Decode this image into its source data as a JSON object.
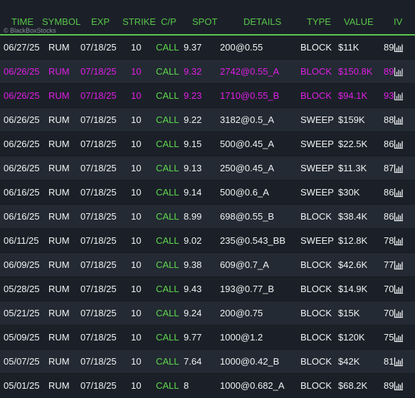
{
  "header": {
    "columns": [
      "TIME",
      "SYMBOL",
      "EXP",
      "STRIKE",
      "C/P",
      "SPOT",
      "DETAILS",
      "TYPE",
      "VALUE",
      "IV"
    ],
    "watermark": "© BlackBoxStocks"
  },
  "icons": {
    "iv_chart": "bar-chart-icon"
  },
  "colors": {
    "header_text": "#58c64a",
    "call_text": "#5fd84d",
    "highlight_text": "#e11ee6",
    "row_text": "#f1f3f5"
  },
  "rows": [
    {
      "time": "06/27/25",
      "symbol": "RUM",
      "exp": "07/18/25",
      "strike": "10",
      "cp": "CALL",
      "spot": "9.37",
      "details": "200@0.55",
      "type": "BLOCK",
      "value": "$11K",
      "iv": "89",
      "highlight": false
    },
    {
      "time": "06/26/25",
      "symbol": "RUM",
      "exp": "07/18/25",
      "strike": "10",
      "cp": "CALL",
      "spot": "9.32",
      "details": "2742@0.55_A",
      "type": "BLOCK",
      "value": "$150.8K",
      "iv": "89",
      "highlight": true
    },
    {
      "time": "06/26/25",
      "symbol": "RUM",
      "exp": "07/18/25",
      "strike": "10",
      "cp": "CALL",
      "spot": "9.23",
      "details": "1710@0.55_B",
      "type": "BLOCK",
      "value": "$94.1K",
      "iv": "93",
      "highlight": true
    },
    {
      "time": "06/26/25",
      "symbol": "RUM",
      "exp": "07/18/25",
      "strike": "10",
      "cp": "CALL",
      "spot": "9.22",
      "details": "3182@0.5_A",
      "type": "SWEEP",
      "value": "$159K",
      "iv": "88",
      "highlight": false
    },
    {
      "time": "06/26/25",
      "symbol": "RUM",
      "exp": "07/18/25",
      "strike": "10",
      "cp": "CALL",
      "spot": "9.15",
      "details": "500@0.45_A",
      "type": "SWEEP",
      "value": "$22.5K",
      "iv": "86",
      "highlight": false
    },
    {
      "time": "06/26/25",
      "symbol": "RUM",
      "exp": "07/18/25",
      "strike": "10",
      "cp": "CALL",
      "spot": "9.13",
      "details": "250@0.45_A",
      "type": "SWEEP",
      "value": "$11.3K",
      "iv": "87",
      "highlight": false
    },
    {
      "time": "06/16/25",
      "symbol": "RUM",
      "exp": "07/18/25",
      "strike": "10",
      "cp": "CALL",
      "spot": "9.14",
      "details": "500@0.6_A",
      "type": "SWEEP",
      "value": "$30K",
      "iv": "86",
      "highlight": false
    },
    {
      "time": "06/16/25",
      "symbol": "RUM",
      "exp": "07/18/25",
      "strike": "10",
      "cp": "CALL",
      "spot": "8.99",
      "details": "698@0.55_B",
      "type": "BLOCK",
      "value": "$38.4K",
      "iv": "86",
      "highlight": false
    },
    {
      "time": "06/11/25",
      "symbol": "RUM",
      "exp": "07/18/25",
      "strike": "10",
      "cp": "CALL",
      "spot": "9.02",
      "details": "235@0.543_BB",
      "type": "SWEEP",
      "value": "$12.8K",
      "iv": "78",
      "highlight": false
    },
    {
      "time": "06/09/25",
      "symbol": "RUM",
      "exp": "07/18/25",
      "strike": "10",
      "cp": "CALL",
      "spot": "9.38",
      "details": "609@0.7_A",
      "type": "BLOCK",
      "value": "$42.6K",
      "iv": "77",
      "highlight": false
    },
    {
      "time": "05/28/25",
      "symbol": "RUM",
      "exp": "07/18/25",
      "strike": "10",
      "cp": "CALL",
      "spot": "9.43",
      "details": "193@0.77_B",
      "type": "BLOCK",
      "value": "$14.9K",
      "iv": "70",
      "highlight": false
    },
    {
      "time": "05/21/25",
      "symbol": "RUM",
      "exp": "07/18/25",
      "strike": "10",
      "cp": "CALL",
      "spot": "9.24",
      "details": "200@0.75",
      "type": "BLOCK",
      "value": "$15K",
      "iv": "70",
      "highlight": false
    },
    {
      "time": "05/09/25",
      "symbol": "RUM",
      "exp": "07/18/25",
      "strike": "10",
      "cp": "CALL",
      "spot": "9.77",
      "details": "1000@1.2",
      "type": "BLOCK",
      "value": "$120K",
      "iv": "75",
      "highlight": false
    },
    {
      "time": "05/07/25",
      "symbol": "RUM",
      "exp": "07/18/25",
      "strike": "10",
      "cp": "CALL",
      "spot": "7.64",
      "details": "1000@0.42_B",
      "type": "BLOCK",
      "value": "$42K",
      "iv": "81",
      "highlight": false
    },
    {
      "time": "05/01/25",
      "symbol": "RUM",
      "exp": "07/18/25",
      "strike": "10",
      "cp": "CALL",
      "spot": "8",
      "details": "1000@0.682_A",
      "type": "BLOCK",
      "value": "$68.2K",
      "iv": "89",
      "highlight": false
    }
  ]
}
